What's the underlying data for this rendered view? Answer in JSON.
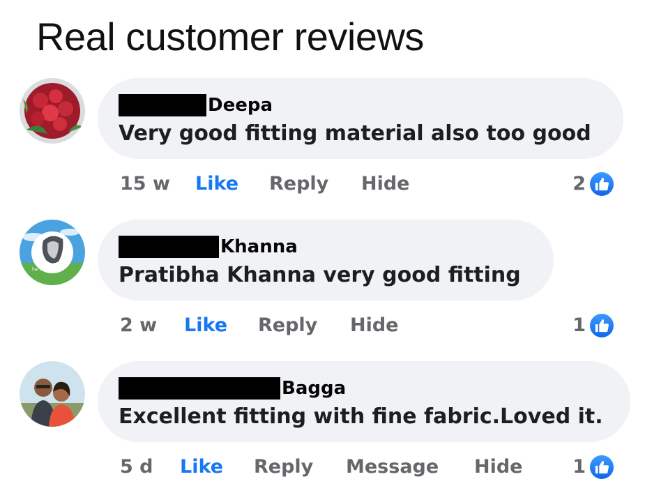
{
  "header": {
    "title": "Real customer reviews"
  },
  "colors": {
    "accent": "#1877f2",
    "bubble": "#f0f2f5",
    "meta_text": "#65676b"
  },
  "comments": [
    {
      "author": "Deepa",
      "text": "Very good fitting material  also too good",
      "time": "15 w",
      "like_label": "Like",
      "reply_label": "Reply",
      "hide_label": "Hide",
      "reaction_count": "2",
      "avatar_icon": "roses-avatar-icon"
    },
    {
      "author": "Khanna",
      "text": "Pratibha Khanna  very good fitting",
      "time": "2 w",
      "like_label": "Like",
      "reply_label": "Reply",
      "hide_label": "Hide",
      "reaction_count": "1",
      "avatar_icon": "portrait-avatar-icon"
    },
    {
      "author": "Bagga",
      "text": "Excellent fitting with fine fabric.Loved it.",
      "time": "5 d",
      "like_label": "Like",
      "reply_label": "Reply",
      "message_label": "Message",
      "hide_label": "Hide",
      "reaction_count": "1",
      "avatar_icon": "couple-photo-avatar-icon"
    }
  ]
}
